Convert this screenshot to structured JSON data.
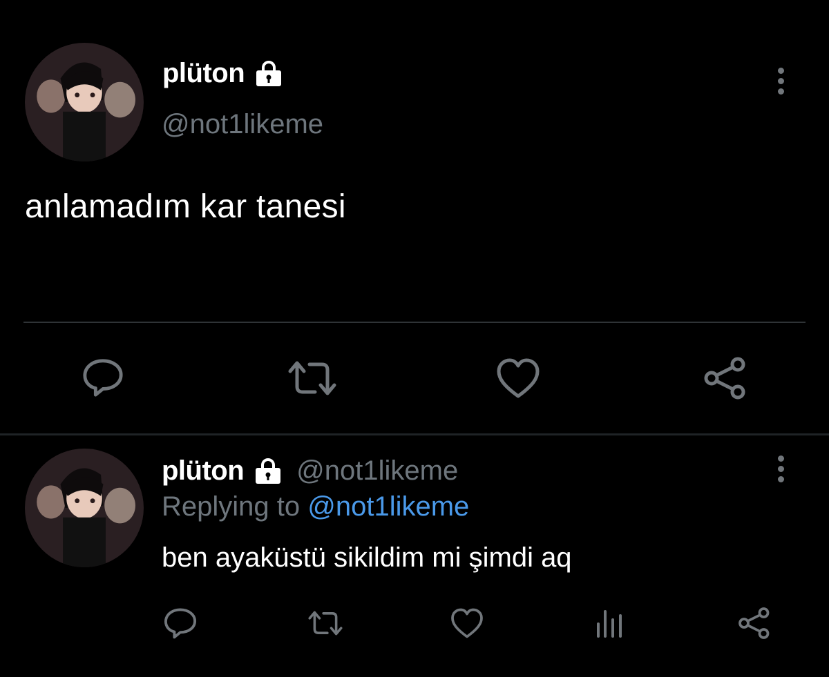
{
  "main_tweet": {
    "display_name": "plüton",
    "handle": "@not1likeme",
    "text": "anlamadım kar tanesi"
  },
  "reply_tweet": {
    "display_name": "plüton",
    "handle": "@not1likeme",
    "replying_prefix": "Replying to",
    "replying_to": "@not1likeme",
    "text": "ben ayaküstü sikildim mi şimdi aq"
  },
  "icons": {
    "lock": "lock-icon",
    "more": "more-vertical-icon",
    "reply": "reply-bubble-icon",
    "retweet": "retweet-icon",
    "like": "heart-icon",
    "share": "share-icon",
    "stats": "analytics-icon"
  },
  "colors": {
    "background": "#000000",
    "text_primary": "#ffffff",
    "text_secondary": "#6e767d",
    "mention": "#4a99e9",
    "icon": "#71767b",
    "divider": "#2f3336"
  }
}
